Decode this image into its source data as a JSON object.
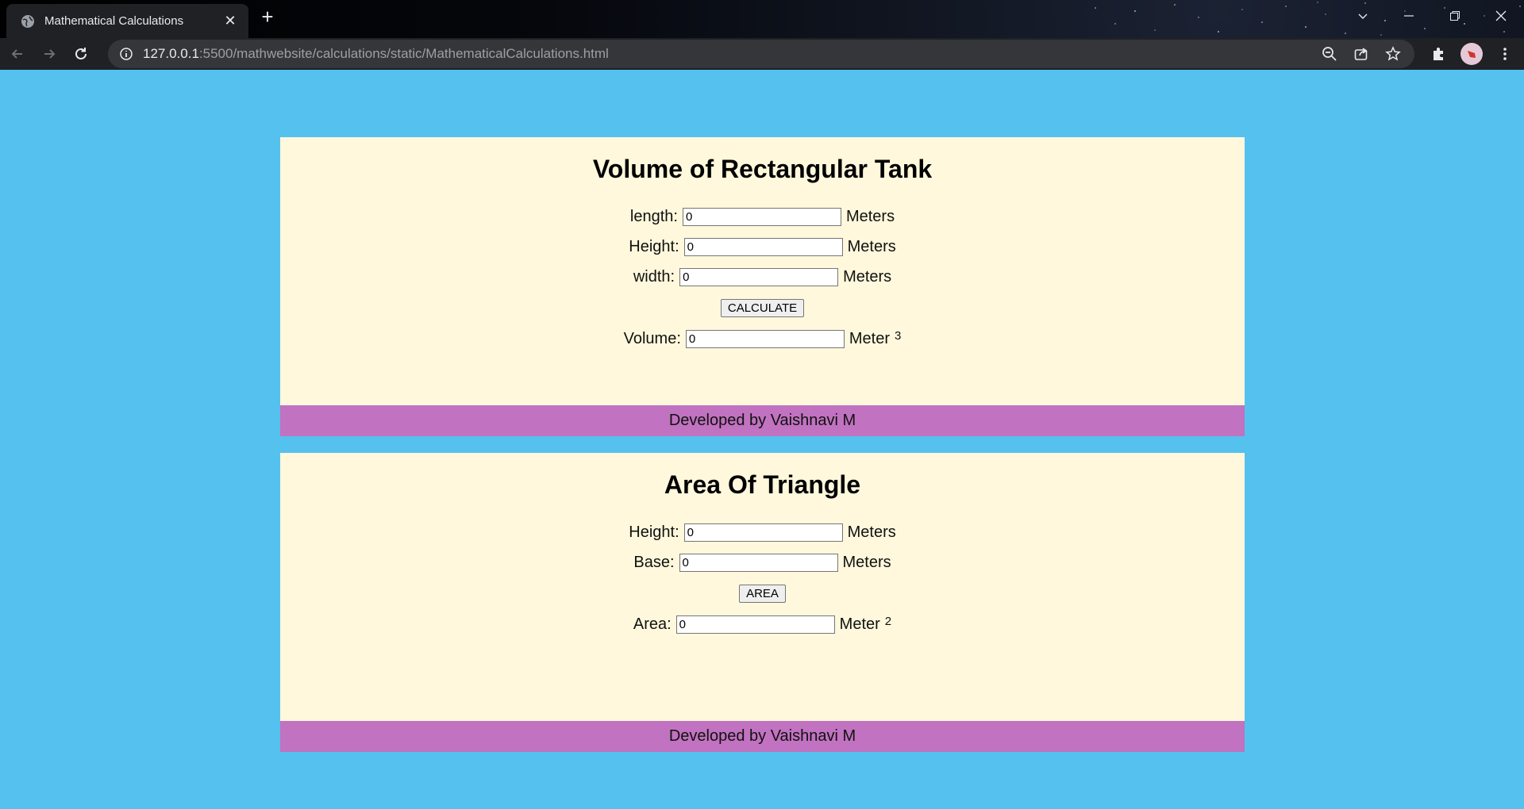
{
  "browser": {
    "tab_title": "Mathematical Calculations",
    "url_host": "127.0.0.1",
    "url_rest": ":5500/mathwebsite/calculations/static/MathematicalCalculations.html"
  },
  "volume_card": {
    "title": "Volume of Rectangular Tank",
    "length_label": "length:",
    "length_value": "0",
    "length_unit": "Meters",
    "height_label": "Height:",
    "height_value": "0",
    "height_unit": "Meters",
    "width_label": "width:",
    "width_value": "0",
    "width_unit": "Meters",
    "button_label": "CALCULATE",
    "result_label": "Volume:",
    "result_value": "0",
    "result_unit": "Meter",
    "result_exponent": "3",
    "footer": "Developed by Vaishnavi M"
  },
  "triangle_card": {
    "title": "Area Of Triangle",
    "height_label": "Height:",
    "height_value": "0",
    "height_unit": "Meters",
    "base_label": "Base:",
    "base_value": "0",
    "base_unit": "Meters",
    "button_label": "AREA",
    "result_label": "Area:",
    "result_value": "0",
    "result_unit": "Meter",
    "result_exponent": "2",
    "footer": "Developed by Vaishnavi M"
  },
  "colors": {
    "page_background": "#55c1ee",
    "card_background": "#fff8dc",
    "footer_background": "#c172c0"
  }
}
